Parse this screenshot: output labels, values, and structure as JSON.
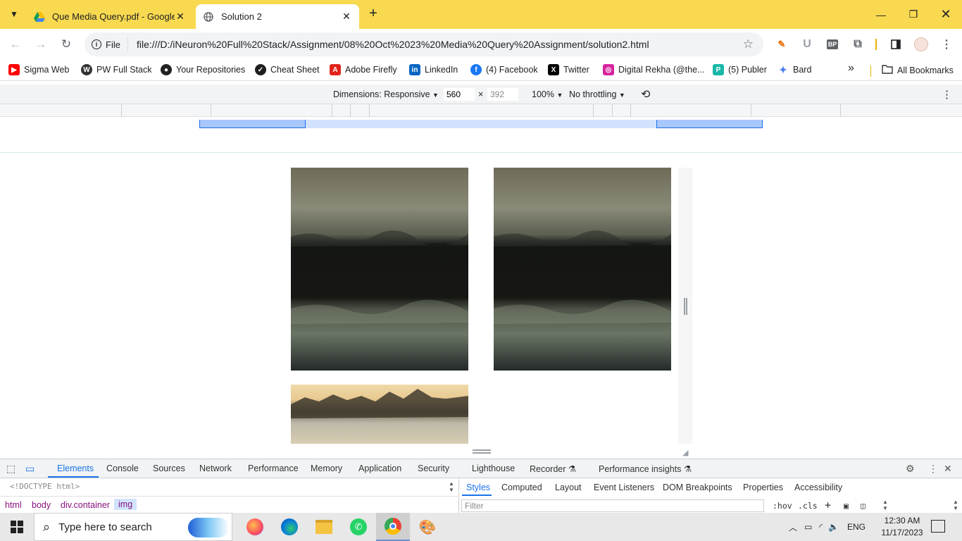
{
  "tabs": [
    {
      "title": "Que Media Query.pdf - Google",
      "icon": "google-drive-icon",
      "active": false
    },
    {
      "title": "Solution 2",
      "icon": "globe-icon",
      "active": true
    }
  ],
  "toolbar": {
    "scheme_label": "File",
    "url": "file:///D:/iNeuron%20Full%20Stack/Assignment/08%20Oct%2023%20Media%20Query%20Assignment/solution2.html"
  },
  "bookmarks": [
    {
      "label": "Sigma Web",
      "icon": "youtube-icon",
      "color": "#ff0000"
    },
    {
      "label": "PW Full Stack",
      "icon": "wordpress-icon",
      "color": "#333333"
    },
    {
      "label": "Your Repositories",
      "icon": "github-icon",
      "color": "#222222"
    },
    {
      "label": "Cheat Sheet",
      "icon": "cheatsheet-icon",
      "color": "#1e7a3c"
    },
    {
      "label": "Adobe Firefly",
      "icon": "adobe-icon",
      "color": "#e1251b"
    },
    {
      "label": "LinkedIn",
      "icon": "linkedin-icon",
      "color": "#0a66c2"
    },
    {
      "label": "(4) Facebook",
      "icon": "facebook-icon",
      "color": "#1877f2"
    },
    {
      "label": "Twitter",
      "icon": "x-icon",
      "color": "#000000"
    },
    {
      "label": "Digital Rekha (@the...",
      "icon": "instagram-icon",
      "color": "#d6249f"
    },
    {
      "label": "(5) Publer",
      "icon": "publer-icon",
      "color": "#18b7a8"
    },
    {
      "label": "Bard",
      "icon": "bard-icon",
      "color": "#4b7bec"
    }
  ],
  "bookmarks_overflow": "»",
  "all_bookmarks": "All Bookmarks",
  "device_toolbar": {
    "dimensions_label": "Dimensions: Responsive",
    "width": "560",
    "height": "392",
    "times": "×",
    "zoom": "100%",
    "throttle": "No throttling"
  },
  "devtools": {
    "tabs": [
      "Elements",
      "Console",
      "Sources",
      "Network",
      "Performance",
      "Memory",
      "Application",
      "Security",
      "Lighthouse",
      "Recorder",
      "Performance insights"
    ],
    "active_tab": "Elements",
    "dom_line": "<!DOCTYPE html>",
    "breadcrumbs": [
      "html",
      "body",
      "div.container",
      "img"
    ],
    "styles_tabs": [
      "Styles",
      "Computed",
      "Layout",
      "Event Listeners",
      "DOM Breakpoints",
      "Properties",
      "Accessibility"
    ],
    "filter_placeholder": "Filter",
    "hov": ":hov",
    "cls": ".cls"
  },
  "taskbar": {
    "search_placeholder": "Type here to search",
    "language": "ENG",
    "time": "12:30 AM",
    "date": "11/17/2023"
  },
  "colors": {
    "tabstrip": "#f8d950",
    "accent": "#1a73e8",
    "mq_bar": "#aecbfa"
  }
}
